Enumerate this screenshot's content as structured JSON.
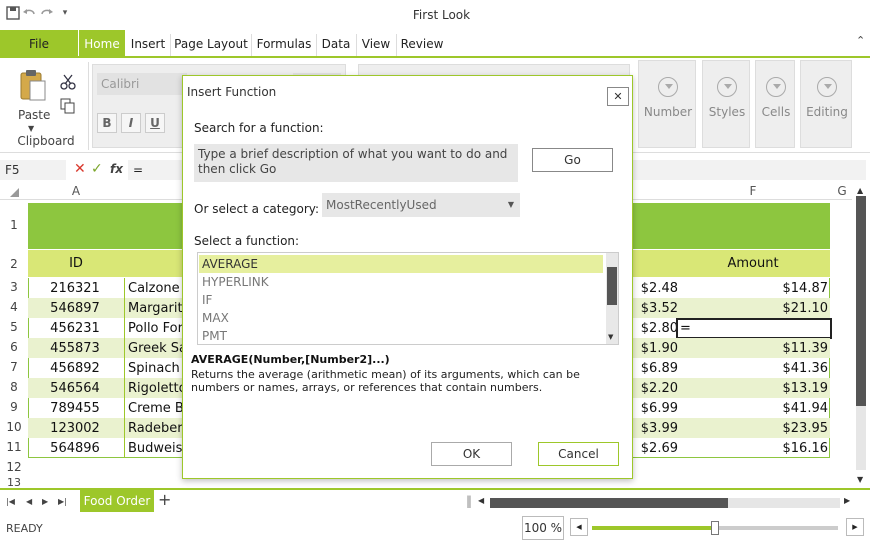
{
  "window": {
    "title": "First Look"
  },
  "ribbon": {
    "file_label": "File",
    "tabs": [
      "Home",
      "Insert",
      "Page Layout",
      "Formulas",
      "Data",
      "View",
      "Review"
    ],
    "clipboard": {
      "paste_label": "Paste",
      "group_label": "Clipboard"
    },
    "font": {
      "name": "Calibri",
      "bold": "B",
      "italic": "I",
      "underline": "U"
    },
    "groups": [
      "Number",
      "Styles",
      "Cells",
      "Editing"
    ]
  },
  "formula_bar": {
    "name_box": "F5",
    "fx": "fx",
    "value": "="
  },
  "sheet": {
    "columns": [
      "A",
      "F",
      "G"
    ],
    "header": {
      "id": "ID",
      "amount": "Amount"
    },
    "row_numbers": [
      "1",
      "2",
      "3",
      "4",
      "5",
      "6",
      "7",
      "8",
      "9",
      "10",
      "11",
      "12",
      "13"
    ],
    "rows": [
      {
        "id": "216321",
        "name": "Calzone",
        "price": "$2.48",
        "amount": "$14.87"
      },
      {
        "id": "546897",
        "name": "Margarita",
        "price": "$3.52",
        "amount": "$21.10"
      },
      {
        "id": "456231",
        "name": "Pollo Forn",
        "price": "$2.80",
        "amount": "="
      },
      {
        "id": "455873",
        "name": "Greek Sal",
        "price": "$1.90",
        "amount": "$11.39"
      },
      {
        "id": "456892",
        "name": "Spinach a",
        "price": "$6.89",
        "amount": "$41.36"
      },
      {
        "id": "546564",
        "name": "Rigoletto",
        "price": "$2.20",
        "amount": "$13.19"
      },
      {
        "id": "789455",
        "name": "Creme Br",
        "price": "$6.99",
        "amount": "$41.94"
      },
      {
        "id": "123002",
        "name": "Radeberg",
        "price": "$3.99",
        "amount": "$23.95"
      },
      {
        "id": "564896",
        "name": "Budweise",
        "price": "$2.69",
        "amount": "$16.16"
      }
    ],
    "sheet_tab": "Food Order",
    "add_sheet": "+"
  },
  "status": {
    "text": "READY",
    "zoom": "100 %",
    "zoom_level": 0.5
  },
  "dialog": {
    "title": "Insert Function",
    "close": "✕",
    "search_label": "Search for a function:",
    "search_placeholder": "Type a brief description of what you want to do and then click Go",
    "go_label": "Go",
    "category_label": "Or select a category:",
    "category_value": "MostRecentlyUsed",
    "function_label": "Select a function:",
    "functions": [
      "AVERAGE",
      "HYPERLINK",
      "IF",
      "MAX",
      "PMT"
    ],
    "signature": "AVERAGE(Number,[Number2]...)",
    "description": "Returns the average (arithmetic mean) of its arguments, which can be numbers or names, arrays, or references that contain numbers.",
    "ok_label": "OK",
    "cancel_label": "Cancel"
  },
  "colors": {
    "accent": "#9dc72a",
    "header_green": "#8dc63f",
    "row_alt": "#eaf2cf",
    "yellow_green": "#d9e776"
  }
}
